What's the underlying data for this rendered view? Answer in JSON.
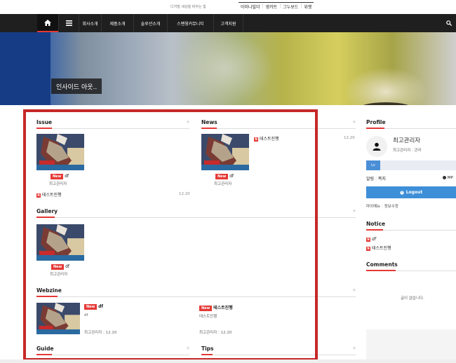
{
  "header": {
    "tagline": "디지털 세상을 바꾸는 힘",
    "top_links": [
      "아미나빌더",
      "영카트",
      "그누보드",
      "위젯"
    ]
  },
  "nav": {
    "items": [
      "회사소개",
      "제품소개",
      "솔루션소개",
      "스펜윙커뮤니티",
      "고객지원"
    ]
  },
  "hero": {
    "caption": "인사이드 아웃.."
  },
  "issue": {
    "title": "Issue",
    "card": {
      "badge": "New",
      "title": "df",
      "author": "최고관리자"
    },
    "list": [
      {
        "title": "테스트진행",
        "date": "12.20"
      }
    ]
  },
  "news": {
    "title": "News",
    "list": [
      {
        "title": "테스트진행",
        "date": "12.20"
      }
    ],
    "card": {
      "badge": "New",
      "title": "df",
      "author": "최고관리자"
    }
  },
  "gallery": {
    "title": "Gallery",
    "card": {
      "badge": "New",
      "title": "df",
      "author": "최고관리자"
    }
  },
  "webzine": {
    "title": "Webzine",
    "items": [
      {
        "badge": "New",
        "title": "df",
        "excerpt": "df",
        "author": "최고관리자",
        "date": "12.20"
      },
      {
        "badge": "New",
        "title": "테스트진행",
        "excerpt": "테스트진행",
        "author": "최고관리자",
        "date": "12.20"
      }
    ]
  },
  "guide": {
    "title": "Guide"
  },
  "tips": {
    "title": "Tips"
  },
  "profile": {
    "title": "Profile",
    "name": "최고관리자",
    "sub": "최고관리자 · 관리",
    "level_label": "Lv",
    "links": [
      "알림",
      "쪽지"
    ],
    "mp_label": "MP",
    "logout": "Logout",
    "bottom_links": [
      "마이메뉴",
      "정보수정"
    ]
  },
  "notice": {
    "title": "Notice",
    "list": [
      {
        "title": "df"
      },
      {
        "title": "테스트진행"
      }
    ]
  },
  "comments": {
    "title": "Comments",
    "empty": "글이 없습니다."
  },
  "colors": {
    "accent": "#e53935",
    "frame": "#c62828",
    "logout": "#3d8fd8"
  }
}
